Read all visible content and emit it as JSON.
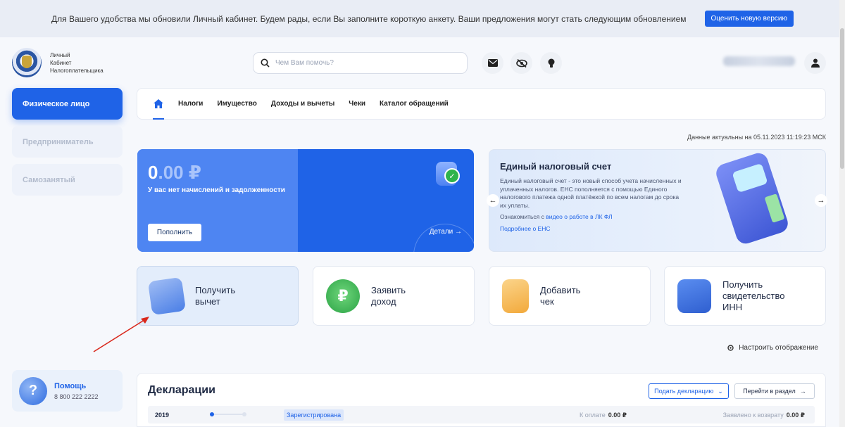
{
  "banner": {
    "text": "Для Вашего удобства мы обновили Личный кабинет. Будем рады, если Вы заполните короткую анкету. Ваши предложения могут стать следующим обновлением",
    "button": "Оценить новую версию"
  },
  "header": {
    "logo_line1": "Личный",
    "logo_line2": "Кабинет",
    "logo_line3": "Налогоплательщика",
    "search_placeholder": "Чем Вам помочь?",
    "icons": [
      "mail-icon",
      "eye-off-icon",
      "lightbulb-icon",
      "user-icon"
    ]
  },
  "sidebar": {
    "items": [
      {
        "label": "Физическое лицо"
      },
      {
        "label": "Предприниматель"
      },
      {
        "label": "Самозанятый"
      }
    ],
    "help_title": "Помощь",
    "help_phone": "8 800 222 2222"
  },
  "nav": {
    "items": [
      "Налоги",
      "Имущество",
      "Доходы и вычеты",
      "Чеки",
      "Каталог обращений"
    ]
  },
  "updated": "Данные актуальны на 05.11.2023 11:19:23 МСК",
  "balance": {
    "amount_int": "0",
    "amount_dec": ".00 ₽",
    "subtitle": "У вас нет начислений и задолженности",
    "pay_button": "Пополнить",
    "details": "Детали"
  },
  "ens": {
    "title": "Единый налоговый счет",
    "description": "Единый налоговый счет - это новый способ учета начисленных и уплаченных налогов. ЕНС пополняется с помощью Единого налогового платежа одной платёжкой по всем налогам до срока их уплаты.",
    "learn_prefix": "Ознакомиться с",
    "learn_link": "видео о работе в ЛК ФЛ",
    "more": "Подробнее о ЕНС"
  },
  "tiles": [
    {
      "label": "Получить\nвычет"
    },
    {
      "label": "Заявить\nдоход"
    },
    {
      "label": "Добавить\nчек"
    },
    {
      "label": "Получить\nсвидетельство\nИНН"
    }
  ],
  "settings_label": "Настроить отображение",
  "declarations": {
    "title": "Декларации",
    "submit_button": "Подать декларацию",
    "goto_button": "Перейти в раздел",
    "row": {
      "year": "2019",
      "status": "Зарегистрирована",
      "to_pay_label": "К оплате",
      "to_pay_value": "0.00 ₽",
      "refund_label": "Заявлено к возврату",
      "refund_value": "0.00 ₽"
    }
  },
  "colors": {
    "accent": "#1f63e7",
    "annotation_arrow": "#d9281c"
  }
}
